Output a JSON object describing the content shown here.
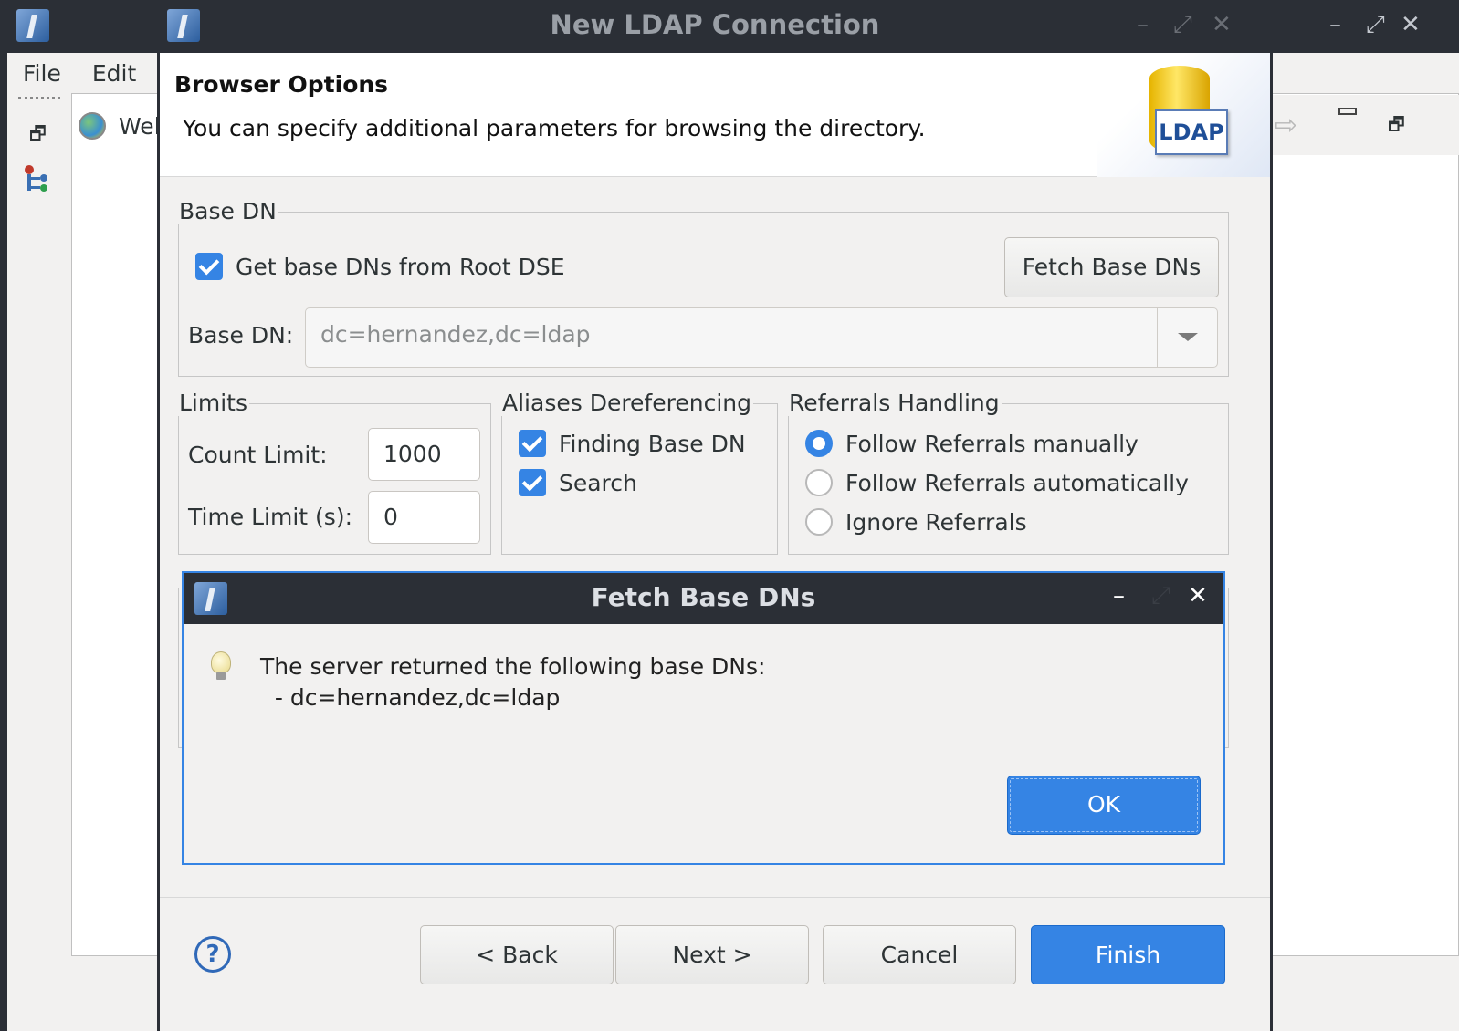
{
  "background_app": {
    "menu": [
      "File",
      "Edit"
    ],
    "tab_label": "Wel"
  },
  "dialog": {
    "title": "New LDAP Connection",
    "banner_title": "Browser Options",
    "banner_description": "You can specify additional parameters for browsing the directory.",
    "logo_text": "LDAP",
    "base_dn_group": {
      "label": "Base DN",
      "get_from_root_dse_label": "Get base DNs from Root DSE",
      "get_from_root_dse_checked": true,
      "fetch_button": "Fetch Base DNs",
      "base_dn_label": "Base DN:",
      "base_dn_value": "dc=hernandez,dc=ldap"
    },
    "limits_group": {
      "label": "Limits",
      "count_label": "Count Limit:",
      "count_value": "1000",
      "time_label": "Time Limit (s):",
      "time_value": "0"
    },
    "aliases_group": {
      "label": "Aliases Dereferencing",
      "options": [
        {
          "label": "Finding Base DN",
          "checked": true
        },
        {
          "label": "Search",
          "checked": true
        }
      ]
    },
    "referrals_group": {
      "label": "Referrals Handling",
      "options": [
        {
          "label": "Follow Referrals manually",
          "selected": true
        },
        {
          "label": "Follow Referrals automatically",
          "selected": false
        },
        {
          "label": "Ignore Referrals",
          "selected": false
        }
      ]
    },
    "buttons": {
      "back": "< Back",
      "next": "Next >",
      "cancel": "Cancel",
      "finish": "Finish"
    }
  },
  "message_dialog": {
    "title": "Fetch Base DNs",
    "message_line1": "The server returned the following base DNs:",
    "message_line2": "  - dc=hernandez,dc=ldap",
    "ok": "OK"
  },
  "colors": {
    "accent": "#3584e4",
    "titlebar": "#2b2f36",
    "window_bg": "#f2f1f0"
  }
}
